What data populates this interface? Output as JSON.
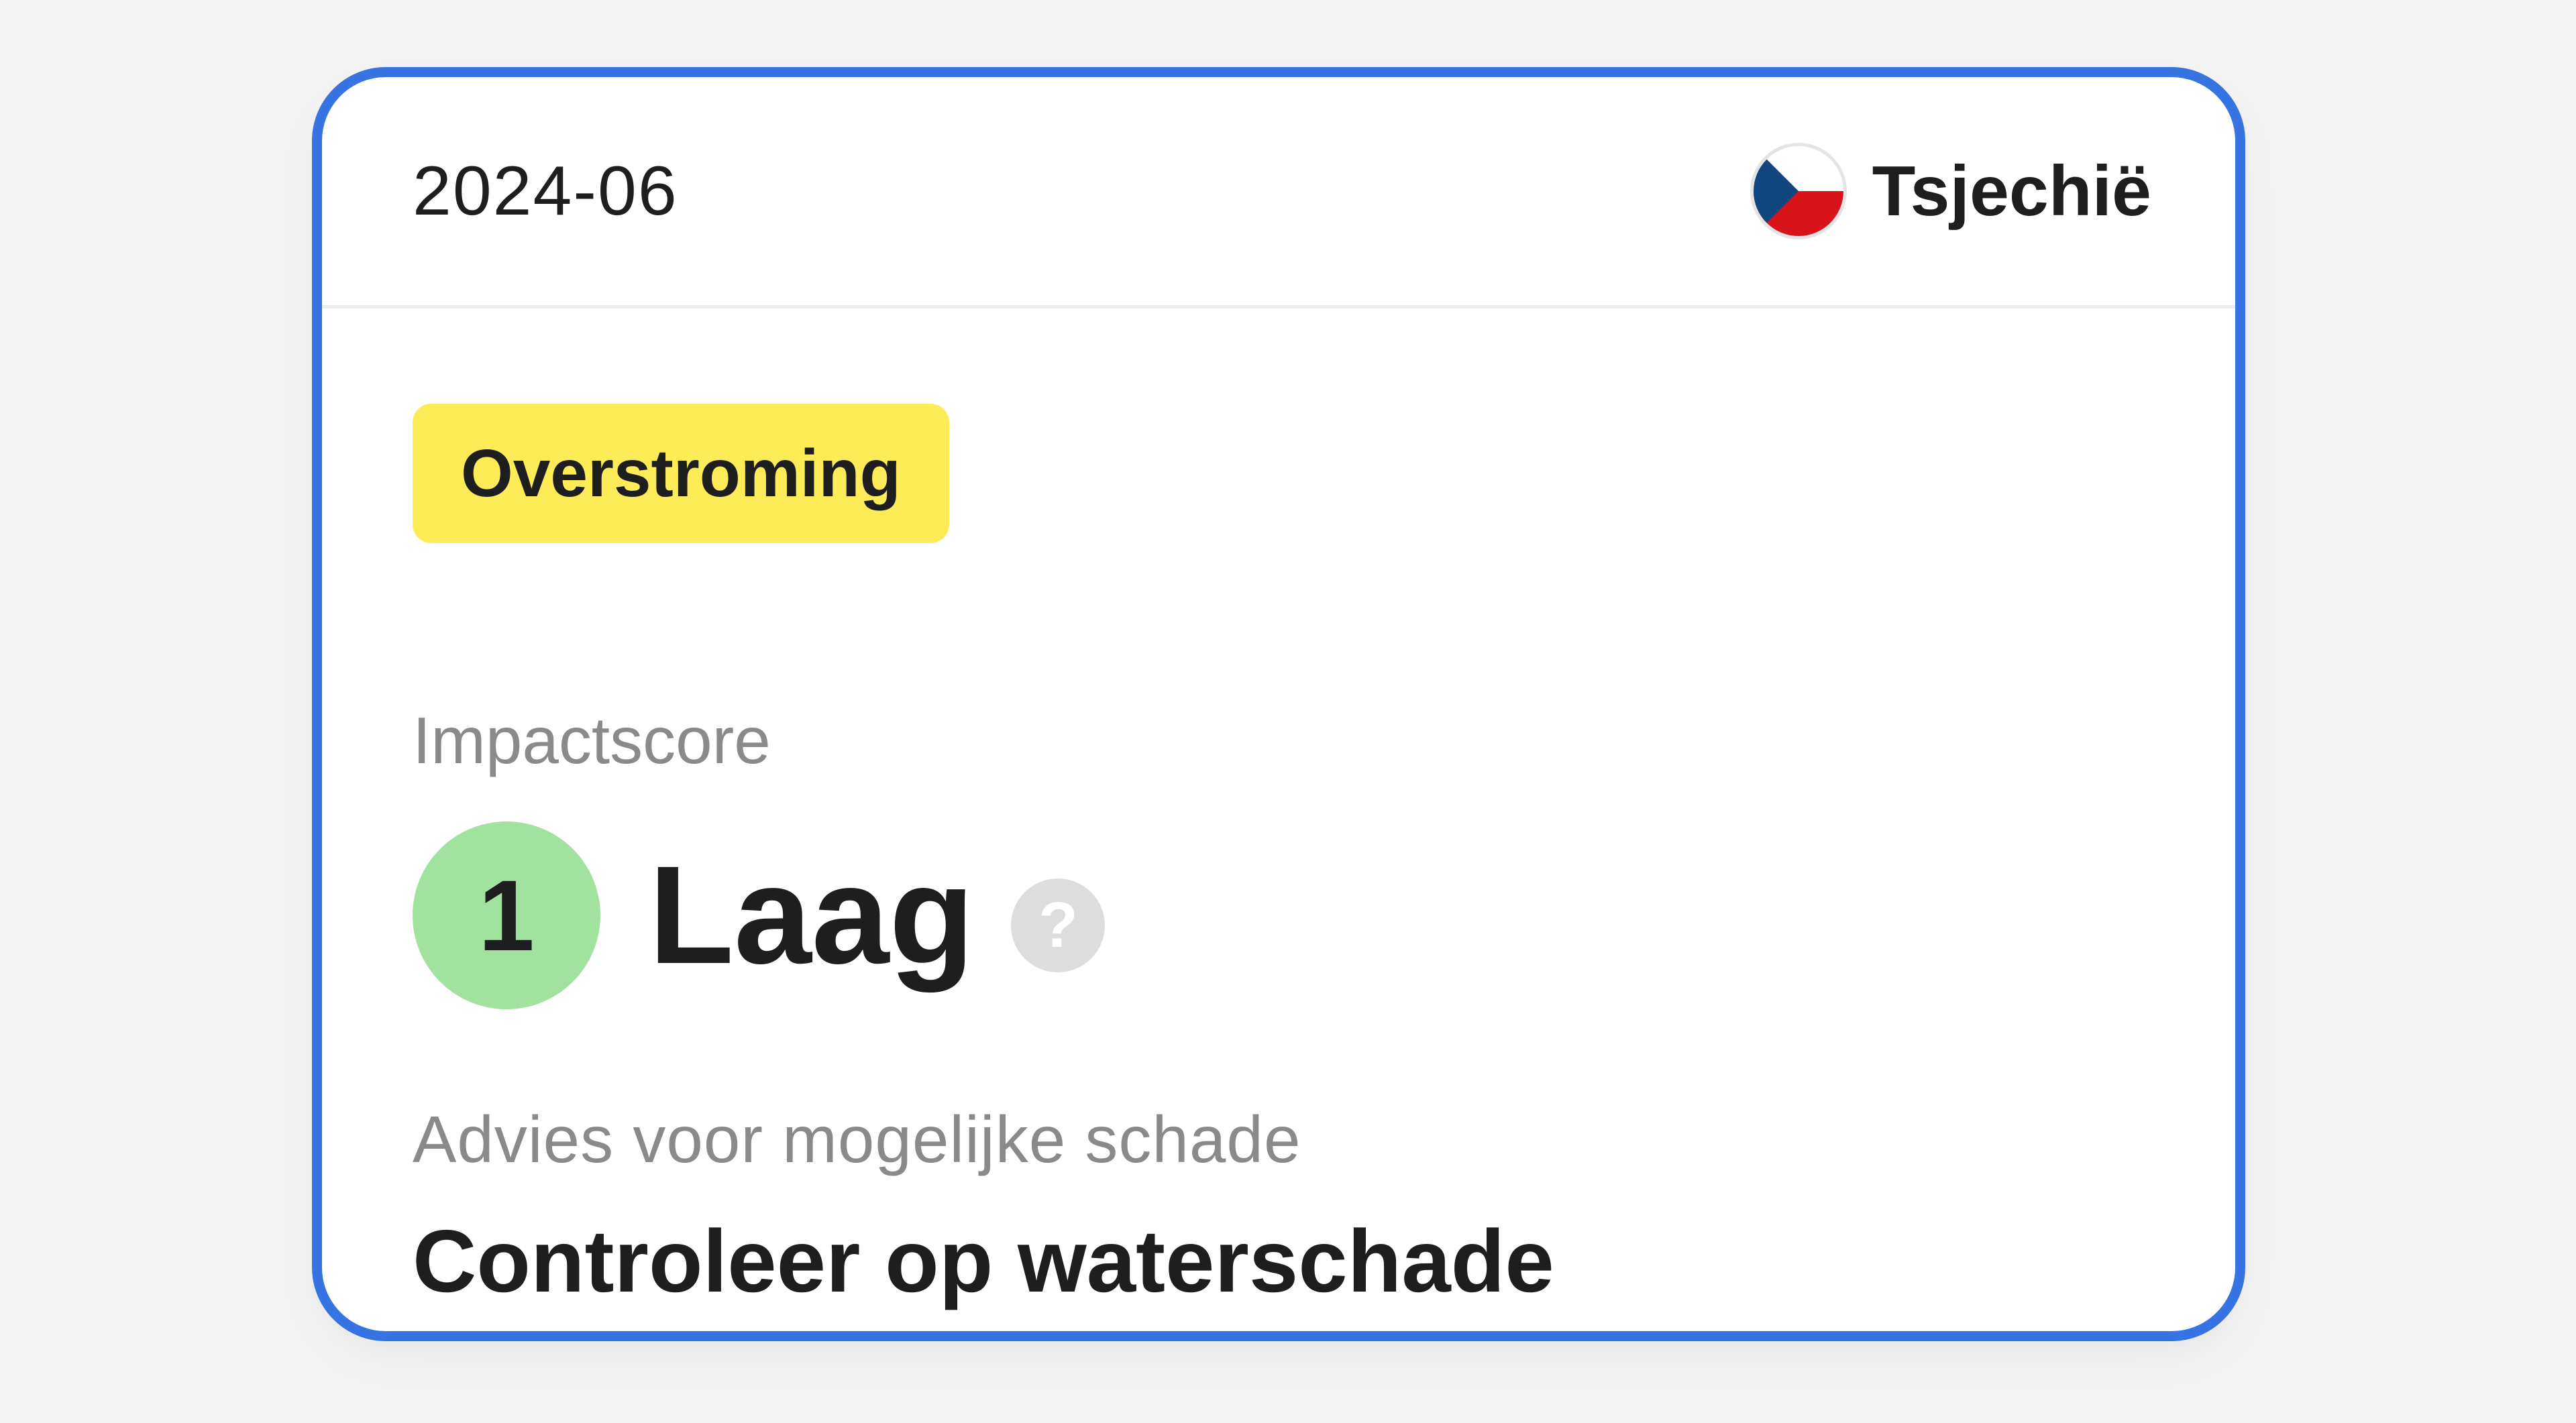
{
  "card": {
    "date": "2024-06",
    "country": {
      "name": "Tsjechië",
      "flag_icon": "czech-flag-icon"
    },
    "event_type": {
      "label": "Overstroming",
      "color": "#fdeb57"
    },
    "impact": {
      "label": "Impactscore",
      "score": "1",
      "level": "Laag",
      "score_color": "#a0e29e",
      "help_icon": "question-mark-icon",
      "help_glyph": "?"
    },
    "advice": {
      "label": "Advies voor mogelijke schade",
      "text": "Controleer op waterschade"
    },
    "accent_color": "#3574e2"
  }
}
